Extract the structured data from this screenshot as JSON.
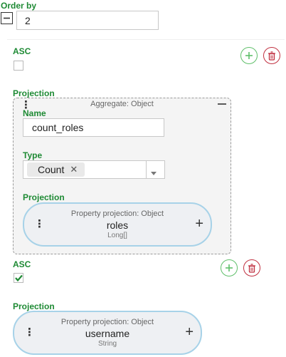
{
  "order_by": {
    "label": "Order by",
    "value": "2"
  },
  "items": [
    {
      "asc_label": "ASC",
      "asc_checked": false,
      "projection_label": "Projection",
      "aggregate": {
        "title": "Aggregate: Object",
        "name_label": "Name",
        "name_value": "count_roles",
        "type_label": "Type",
        "type_chip": "Count",
        "projection_label": "Projection",
        "property": {
          "title": "Property projection: Object",
          "name": "roles",
          "type": "Long[]"
        }
      }
    },
    {
      "asc_label": "ASC",
      "asc_checked": true,
      "projection_label": "Projection",
      "property": {
        "title": "Property projection: Object",
        "name": "username",
        "type": "String"
      }
    }
  ],
  "colors": {
    "label_green": "#1e8a34",
    "add_green": "#5fbf6a",
    "delete_red": "#c03040",
    "pill_border": "#a7d2e8"
  },
  "icons": [
    "collapse-icon",
    "add-icon",
    "delete-icon",
    "kebab-icon",
    "plus-icon",
    "chip-remove-icon",
    "dropdown-arrow-icon",
    "checkmark-icon"
  ]
}
